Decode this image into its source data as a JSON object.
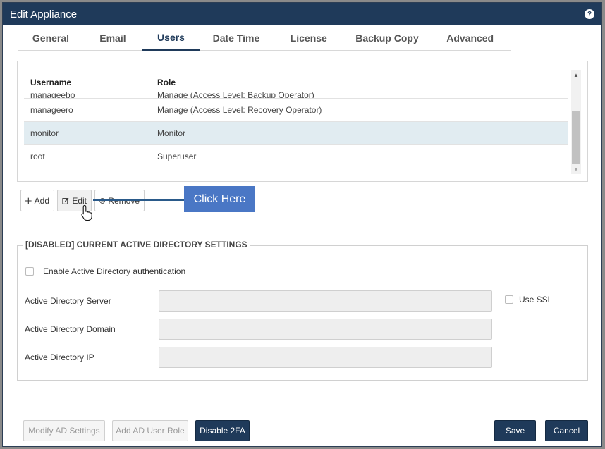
{
  "dialog": {
    "title": "Edit Appliance"
  },
  "tabs": [
    {
      "label": "General"
    },
    {
      "label": "Email"
    },
    {
      "label": "Users"
    },
    {
      "label": "Date Time"
    },
    {
      "label": "License"
    },
    {
      "label": "Backup Copy"
    },
    {
      "label": "Advanced"
    }
  ],
  "active_tab": "Users",
  "users_table": {
    "headers": {
      "username": "Username",
      "role": "Role"
    },
    "rows": [
      {
        "username": "manageebo",
        "role": "Manage (Access Level: Backup Operator)"
      },
      {
        "username": "manageero",
        "role": "Manage (Access Level: Recovery Operator)"
      },
      {
        "username": "monitor",
        "role": "Monitor",
        "selected": true
      },
      {
        "username": "root",
        "role": "Superuser"
      }
    ]
  },
  "user_actions": {
    "add": "Add",
    "edit": "Edit",
    "remove": "Remove"
  },
  "callout": {
    "text": "Click Here"
  },
  "ad_settings": {
    "legend": "[DISABLED] CURRENT ACTIVE DIRECTORY SETTINGS",
    "enable_label": "Enable Active Directory authentication",
    "server_label": "Active Directory Server",
    "domain_label": "Active Directory Domain",
    "ip_label": "Active Directory IP",
    "ssl_label": "Use SSL",
    "server_value": "",
    "domain_value": "",
    "ip_value": ""
  },
  "footer": {
    "modify_ad": "Modify AD Settings",
    "add_ad_role": "Add AD User Role",
    "disable_2fa": "Disable 2FA",
    "save": "Save",
    "cancel": "Cancel"
  },
  "colors": {
    "primary": "#1f3a5a",
    "selected_row": "#e1ecf1",
    "callout": "#4a77c5"
  }
}
